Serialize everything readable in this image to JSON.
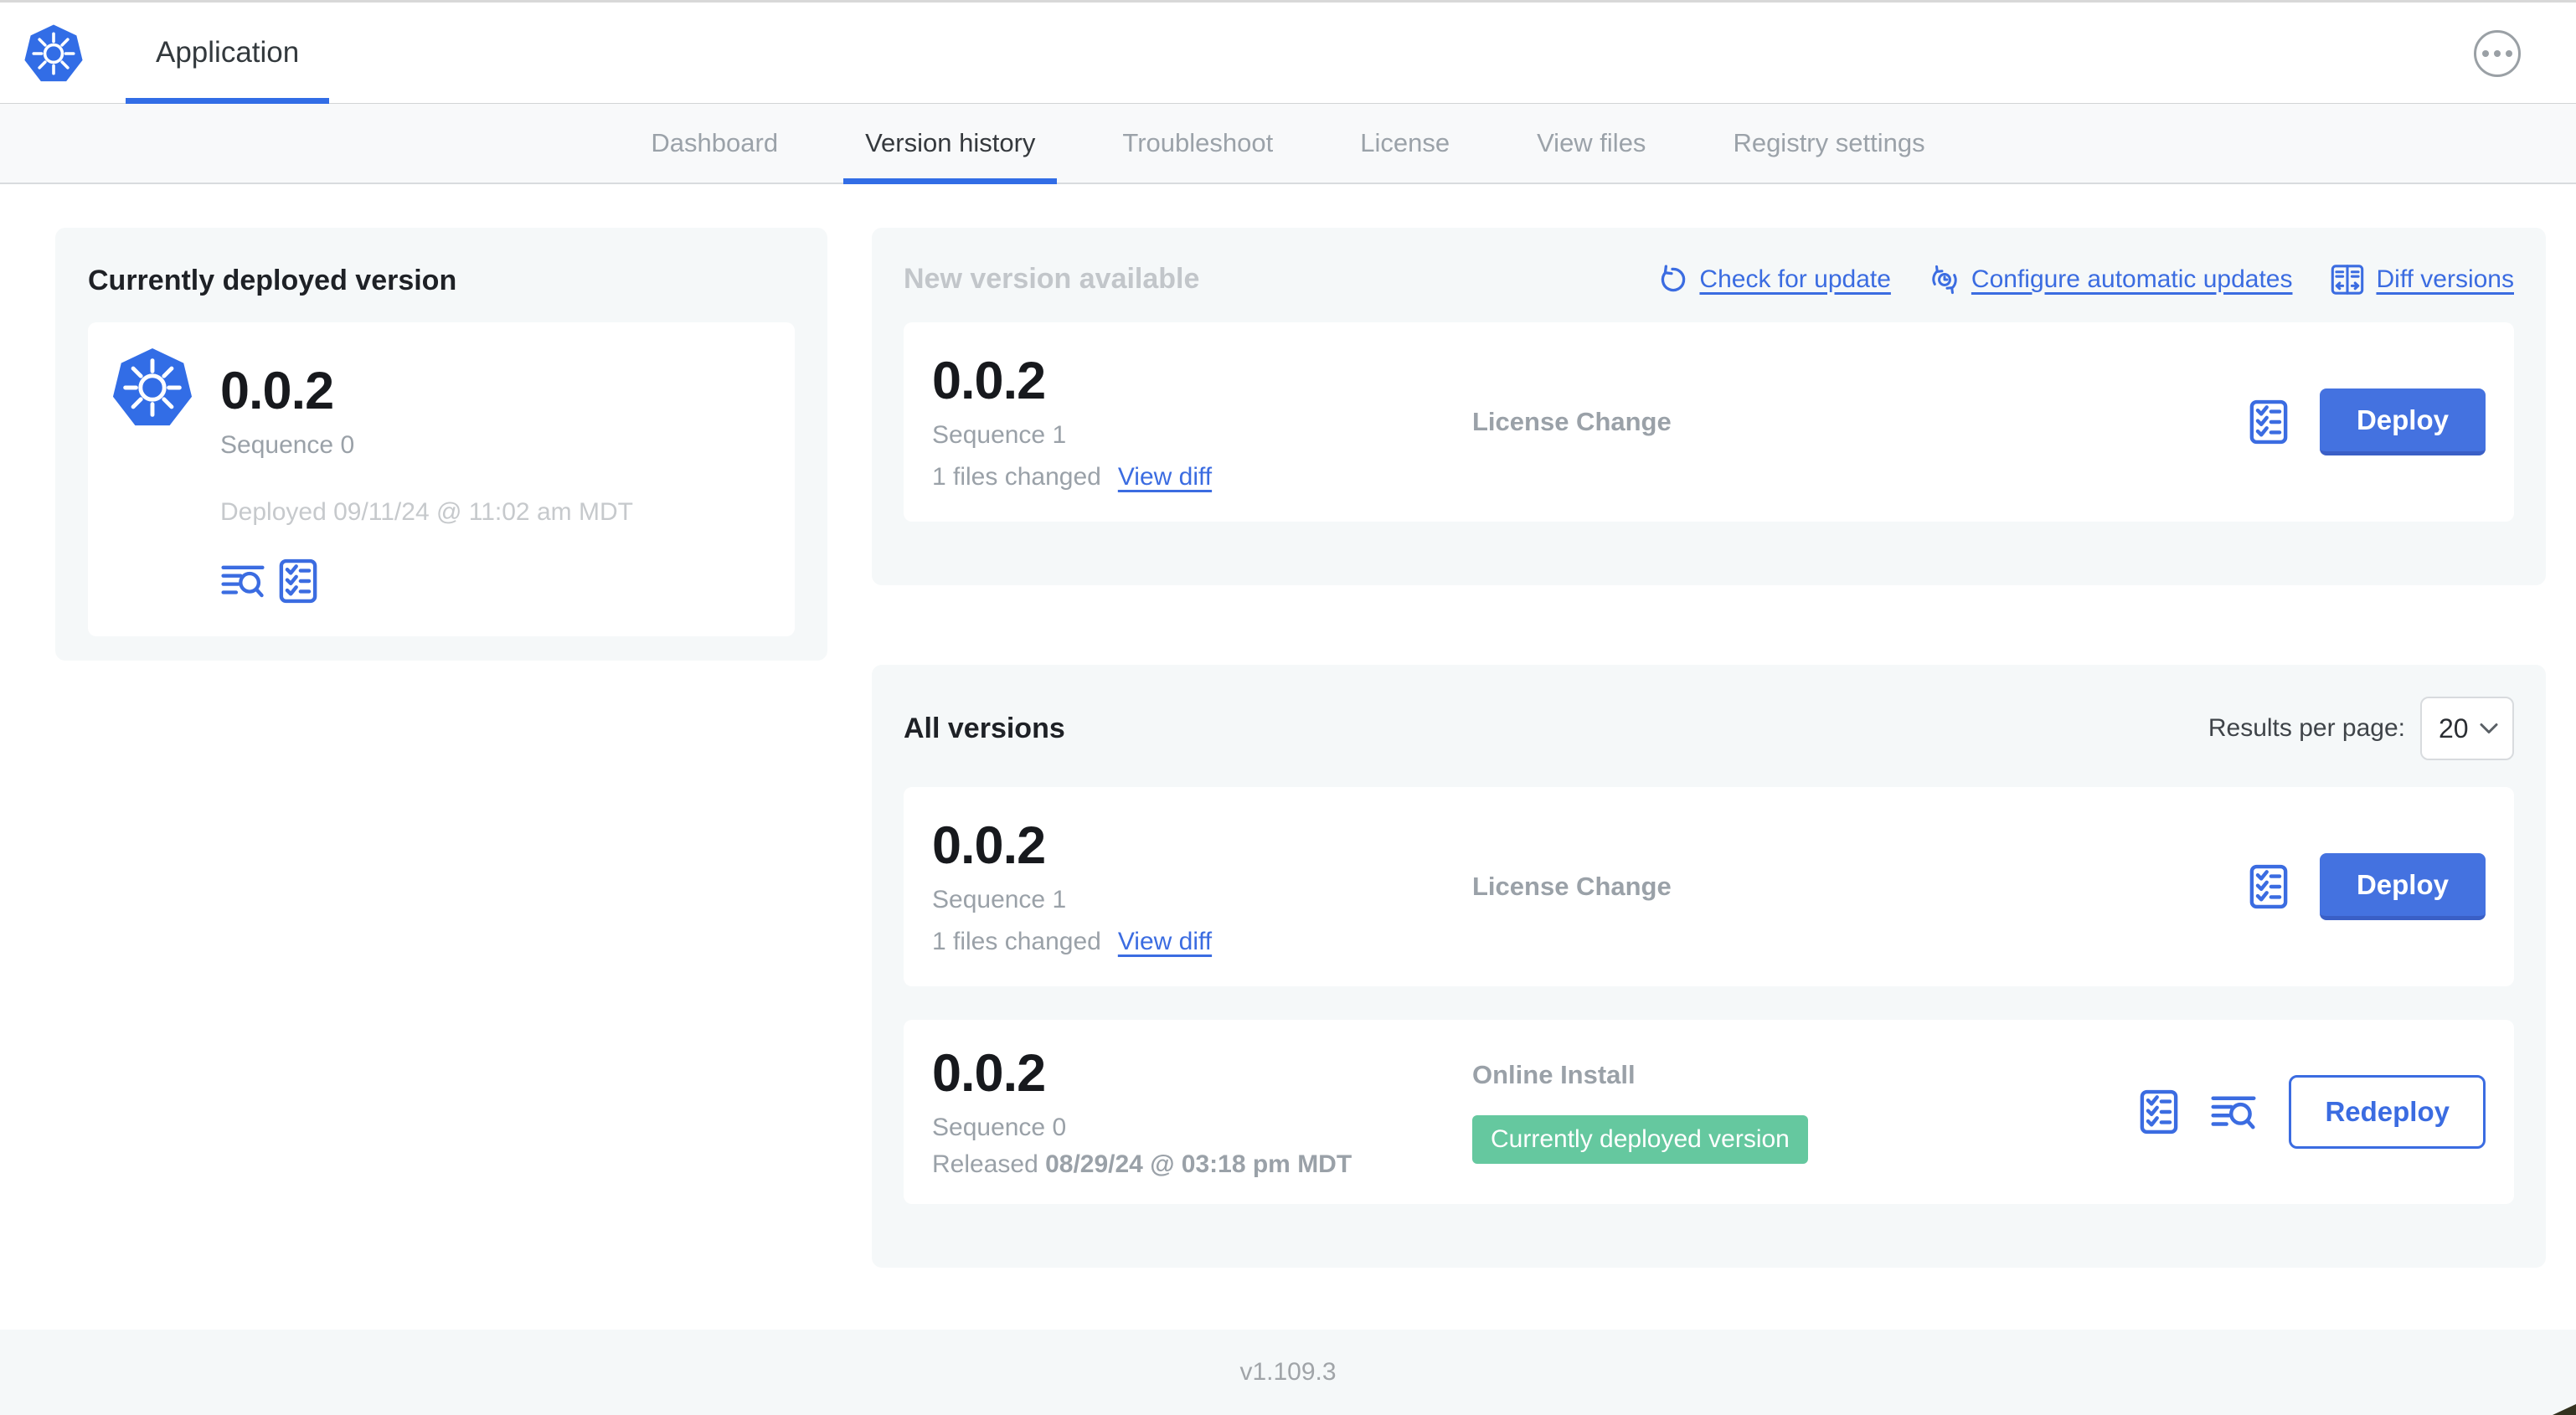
{
  "header": {
    "app_label": "Application",
    "more_icon": "ellipsis-icon"
  },
  "nav": {
    "tabs": [
      {
        "label": "Dashboard",
        "active": false
      },
      {
        "label": "Version history",
        "active": true
      },
      {
        "label": "Troubleshoot",
        "active": false
      },
      {
        "label": "License",
        "active": false
      },
      {
        "label": "View files",
        "active": false
      },
      {
        "label": "Registry settings",
        "active": false
      }
    ]
  },
  "deployed": {
    "title": "Currently deployed version",
    "version": "0.0.2",
    "sequence": "Sequence 0",
    "deployed_at": "Deployed 09/11/24 @ 11:02 am MDT"
  },
  "newver": {
    "title": "New version available",
    "actions": [
      {
        "label": "Check for update",
        "icon": "refresh-icon"
      },
      {
        "label": "Configure automatic updates",
        "icon": "auto-update-icon"
      },
      {
        "label": "Diff versions",
        "icon": "diff-icon"
      }
    ],
    "card": {
      "version": "0.0.2",
      "sequence": "Sequence 1",
      "files_changed": "1 files changed",
      "view_diff": "View diff",
      "source": "License Change",
      "deploy_label": "Deploy"
    }
  },
  "allver": {
    "title": "All versions",
    "results_label": "Results per page:",
    "results_value": "20",
    "rows": [
      {
        "version": "0.0.2",
        "sequence": "Sequence 1",
        "files_changed": "1 files changed",
        "view_diff": "View diff",
        "source": "License Change",
        "button_label": "Deploy"
      },
      {
        "version": "0.0.2",
        "sequence": "Sequence 0",
        "released_prefix": "Released ",
        "released_date": "08/29/24 @ 03:18 pm MDT",
        "source": "Online Install",
        "badge": "Currently deployed version",
        "button_label": "Redeploy"
      }
    ]
  },
  "footer": {
    "version": "v1.109.3"
  },
  "colors": {
    "accent_blue": "#326de6",
    "link_blue": "#3b6ce1",
    "button_blue": "#4472e0",
    "badge_green": "#65c89f",
    "panel_bg": "#f5f8f9"
  }
}
